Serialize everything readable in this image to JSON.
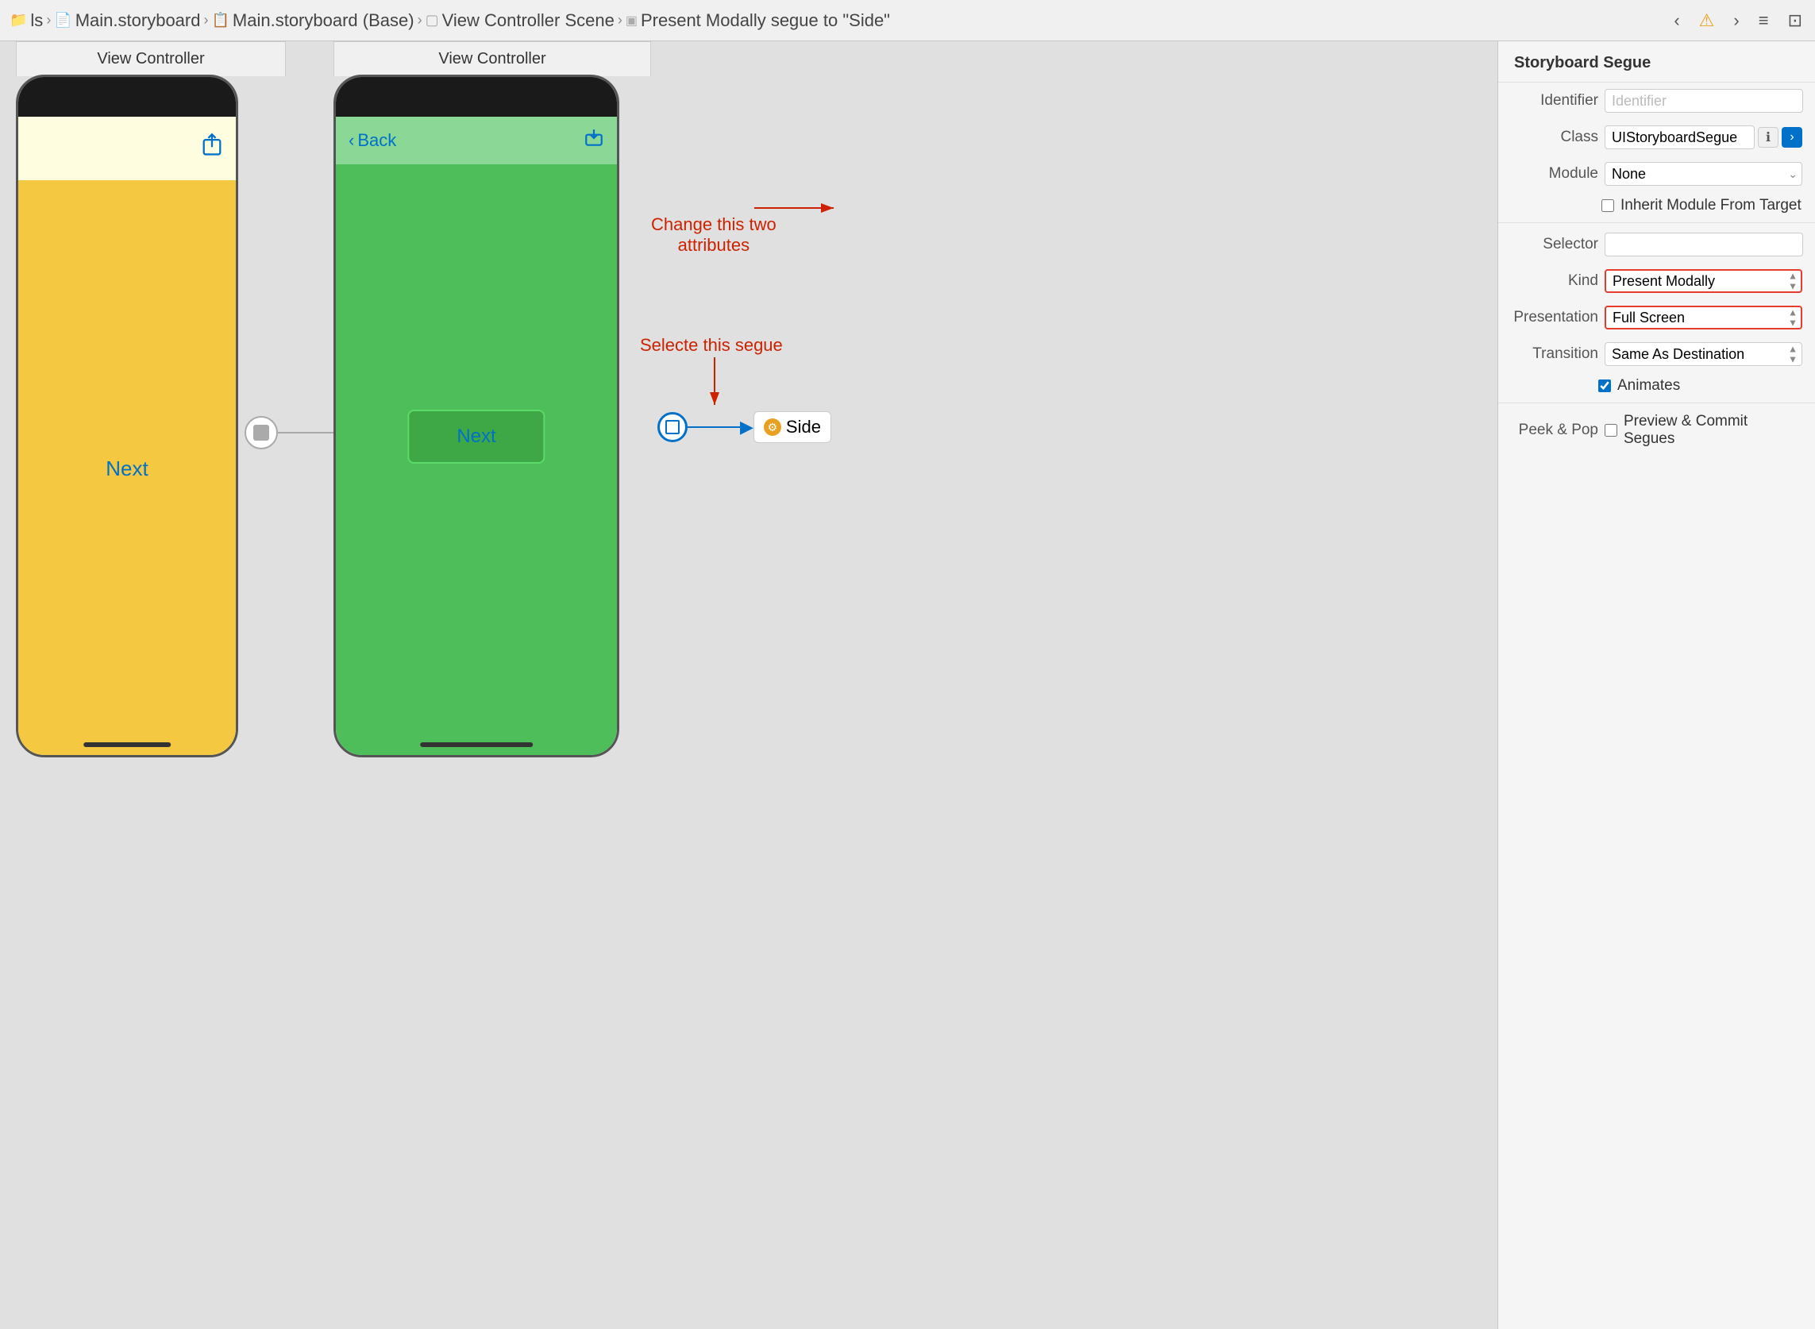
{
  "toolbar": {
    "breadcrumbs": [
      {
        "label": "ls",
        "icon": "folder-icon"
      },
      {
        "label": "Main.storyboard",
        "icon": "file-icon"
      },
      {
        "label": "Main.storyboard (Base)",
        "icon": "storyboard-icon"
      },
      {
        "label": "View Controller Scene",
        "icon": "vc-icon"
      },
      {
        "label": "Present Modally segue to \"Side\"",
        "icon": "segue-icon"
      }
    ],
    "nav_back": "‹",
    "nav_warning": "⚠",
    "nav_forward": "›"
  },
  "vc1": {
    "title": "View Controller",
    "next_label": "Next",
    "share_icon": "↑"
  },
  "vc2": {
    "title": "View Controller",
    "back_label": "Back",
    "next_btn_label": "Next",
    "download_icon": "↓"
  },
  "segue": {
    "destination_label": "Side"
  },
  "annotations": {
    "change_text": "Change this two\nattributes",
    "select_text": "Selecte this segue"
  },
  "panel": {
    "title": "Storyboard Segue",
    "identifier_label": "Identifier",
    "identifier_placeholder": "Identifier",
    "class_label": "Class",
    "class_value": "UIStoryboardSegue",
    "module_label": "Module",
    "module_value": "None",
    "inherit_label": "Inherit Module From Target",
    "selector_label": "Selector",
    "kind_label": "Kind",
    "kind_value": "Present Modally",
    "presentation_label": "Presentation",
    "presentation_value": "Full Screen",
    "transition_label": "Transition",
    "transition_value": "Same As Destination",
    "animates_label": "Animates",
    "peek_label": "Peek & Pop",
    "peek_checkbox_label": "Preview & Commit Segues"
  }
}
